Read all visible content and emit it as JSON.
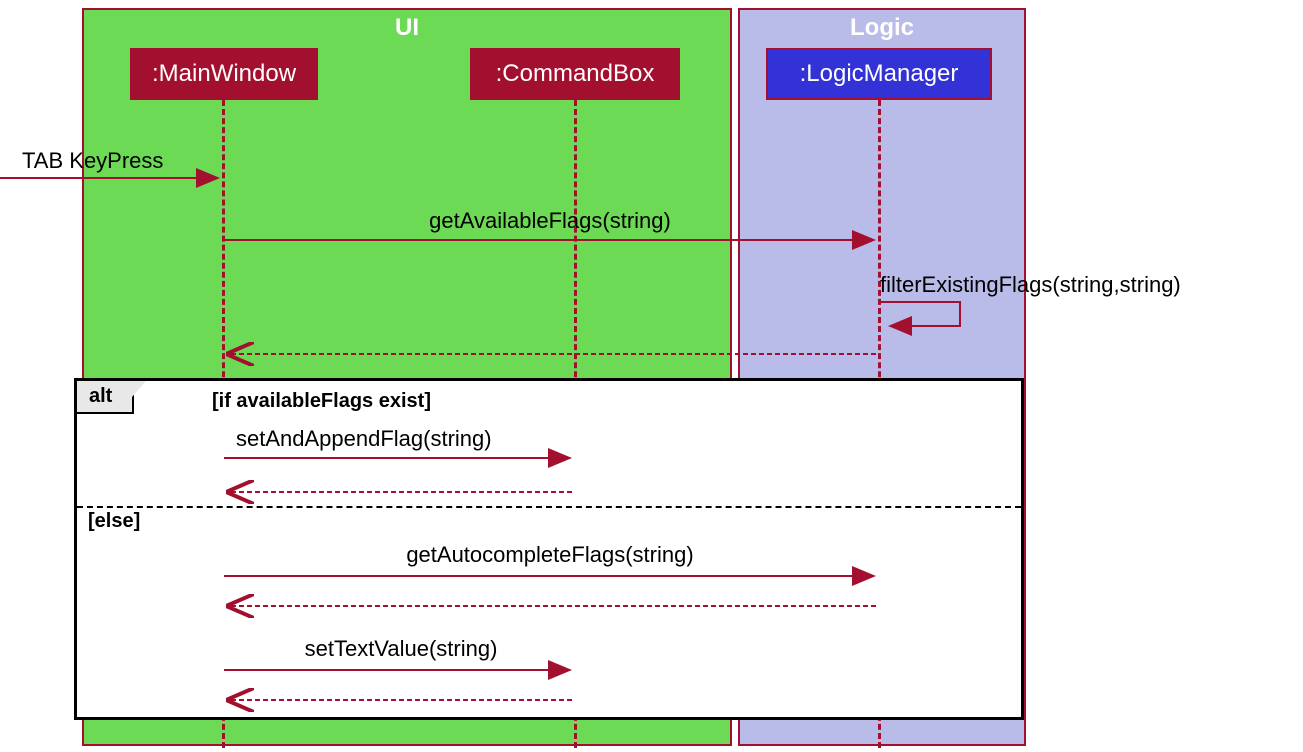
{
  "regions": {
    "ui": {
      "title": "UI"
    },
    "logic": {
      "title": "Logic"
    }
  },
  "lifelines": {
    "mainwindow": ":MainWindow",
    "commandbox": ":CommandBox",
    "logicmanager": ":LogicManager"
  },
  "messages": {
    "tab_keypress": "TAB KeyPress",
    "get_available_flags": "getAvailableFlags(string)",
    "filter_existing_flags": "filterExistingFlags(string,string)",
    "set_and_append_flag": "setAndAppendFlag(string)",
    "get_autocomplete_flags": "getAutocompleteFlags(string)",
    "set_text_value": "setTextValue(string)"
  },
  "alt": {
    "label": "alt",
    "guard_if": "[if availableFlags exist]",
    "guard_else": "[else]"
  }
}
